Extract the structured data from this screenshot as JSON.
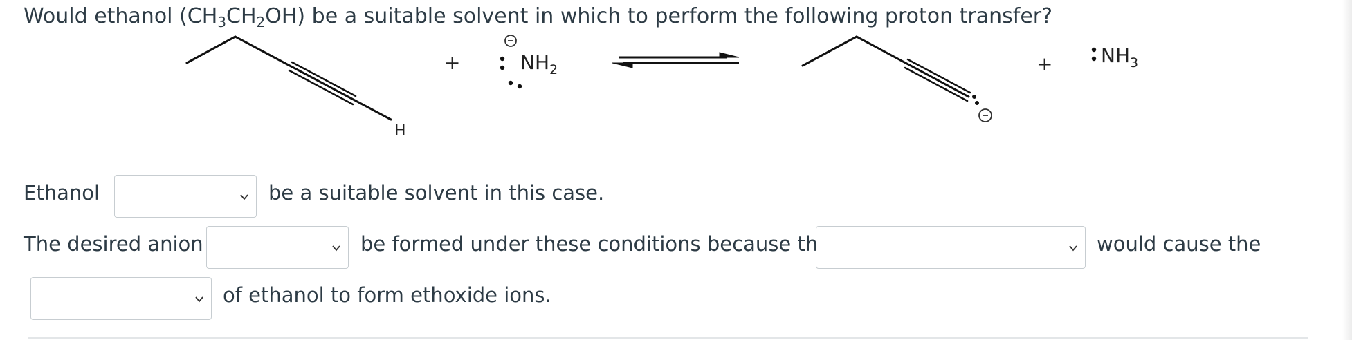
{
  "question": {
    "pre": "Would ethanol (CH",
    "sub1": "3",
    "mid1": "CH",
    "sub2": "2",
    "post": "OH) be a suitable solvent in which to perform the following proton transfer?"
  },
  "reaction": {
    "plus": "+",
    "hydrogen_label": "H",
    "amide": "NH",
    "amide_sub": "2",
    "ammonia": "NH",
    "ammonia_sub": "3"
  },
  "row1": {
    "prefix": "Ethanol",
    "suffix": "be a suitable solvent in this case."
  },
  "row2": {
    "prefix": "The desired anion",
    "middle": "be formed under these conditions because the",
    "suffix": "would cause the"
  },
  "row3": {
    "suffix": "of ethanol to form ethoxide ions."
  },
  "icons": {
    "dropdown": "chevron-down-icon",
    "charge": "negative-charge-icon"
  }
}
